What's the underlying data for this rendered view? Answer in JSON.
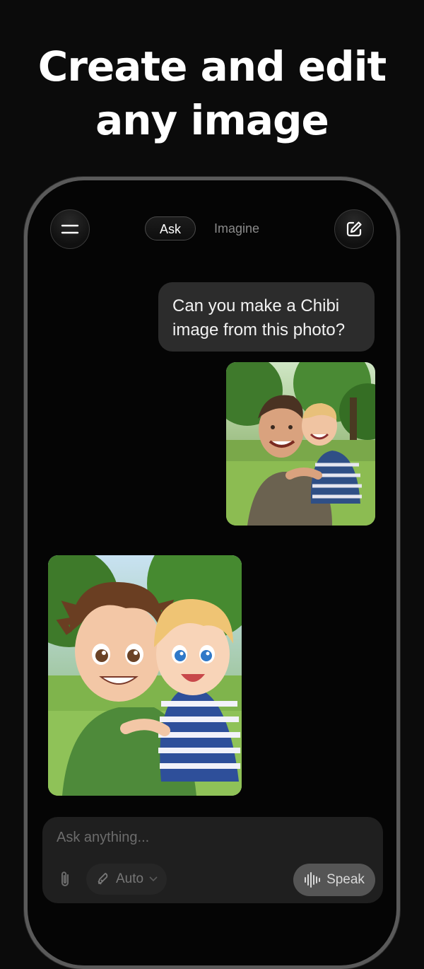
{
  "headline": {
    "line1": "Create and edit",
    "line2": "any image"
  },
  "header": {
    "menu_icon": "hamburger-menu-icon",
    "tabs": [
      {
        "label": "Ask",
        "active": true
      },
      {
        "label": "Imagine",
        "active": false
      }
    ],
    "edit_icon": "new-chat-edit-icon"
  },
  "conversation": {
    "user_message": "Can you make a Chibi image from this photo?",
    "user_attachment": "photo of man and child selfie in park",
    "assistant_image": "chibi-style illustration of man and child"
  },
  "composer": {
    "placeholder": "Ask anything...",
    "attach_icon": "paperclip-icon",
    "mode_label": "Auto",
    "mode_icon": "rocket-icon",
    "speak_label": "Speak",
    "speak_icon": "waveform-icon"
  },
  "colors": {
    "background": "#0b0b0b",
    "bubble": "#2c2c2c",
    "composer": "#1f1f1f",
    "speak_button": "#555555"
  }
}
